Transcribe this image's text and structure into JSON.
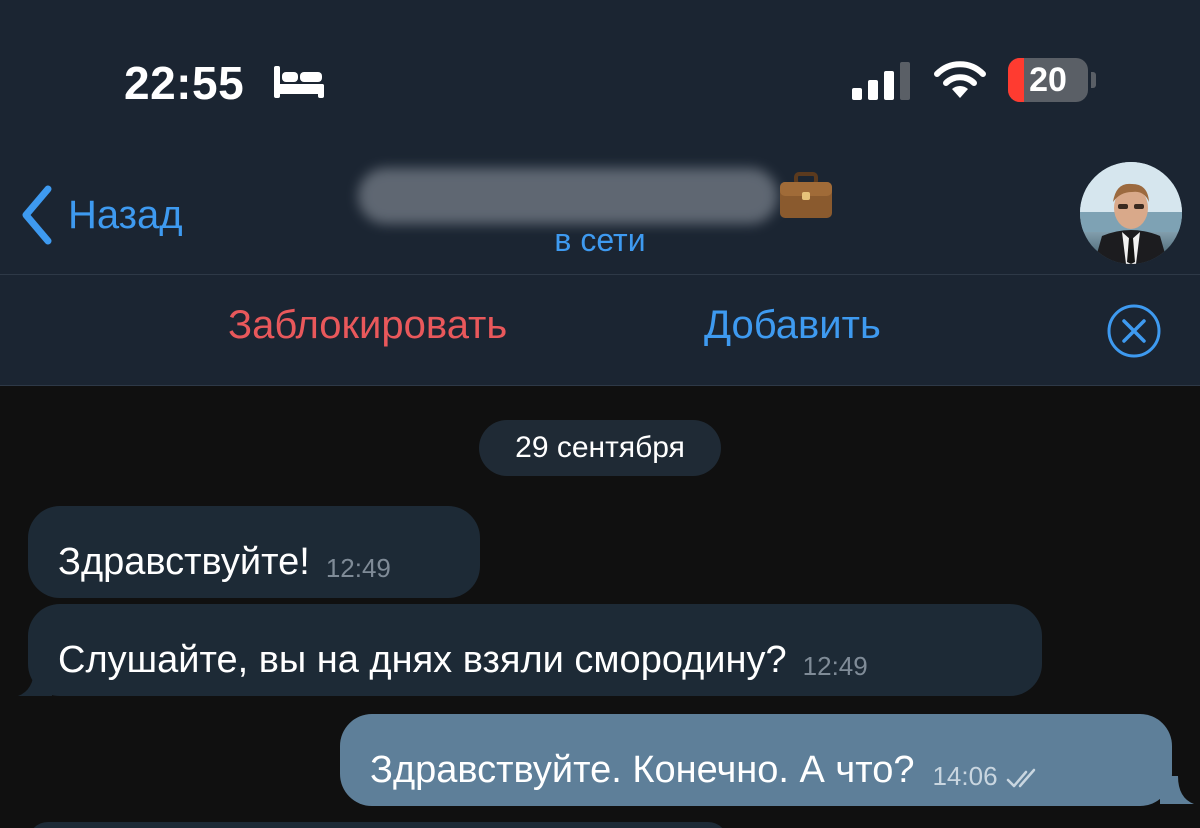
{
  "status_bar": {
    "time": "22:55",
    "battery_level": "20"
  },
  "header": {
    "back_label": "Назад",
    "subtitle": "в сети"
  },
  "actions": {
    "block_label": "Заблокировать",
    "add_label": "Добавить"
  },
  "chat": {
    "date_separator": "29 сентября",
    "messages": [
      {
        "direction": "in",
        "text": "Здравствуйте!",
        "time": "12:49"
      },
      {
        "direction": "in",
        "text": "Слушайте, вы на днях взяли смородину?",
        "time": "12:49"
      },
      {
        "direction": "out",
        "text": "Здравствуйте. Конечно. А что?",
        "time": "14:06",
        "status": "read"
      }
    ]
  },
  "colors": {
    "accent": "#3e9af0",
    "danger": "#e9585b",
    "header_bg": "#1b2532",
    "chat_bg": "#101010",
    "incoming_bubble": "#1d2a36",
    "outgoing_bubble": "#5e7f99"
  }
}
